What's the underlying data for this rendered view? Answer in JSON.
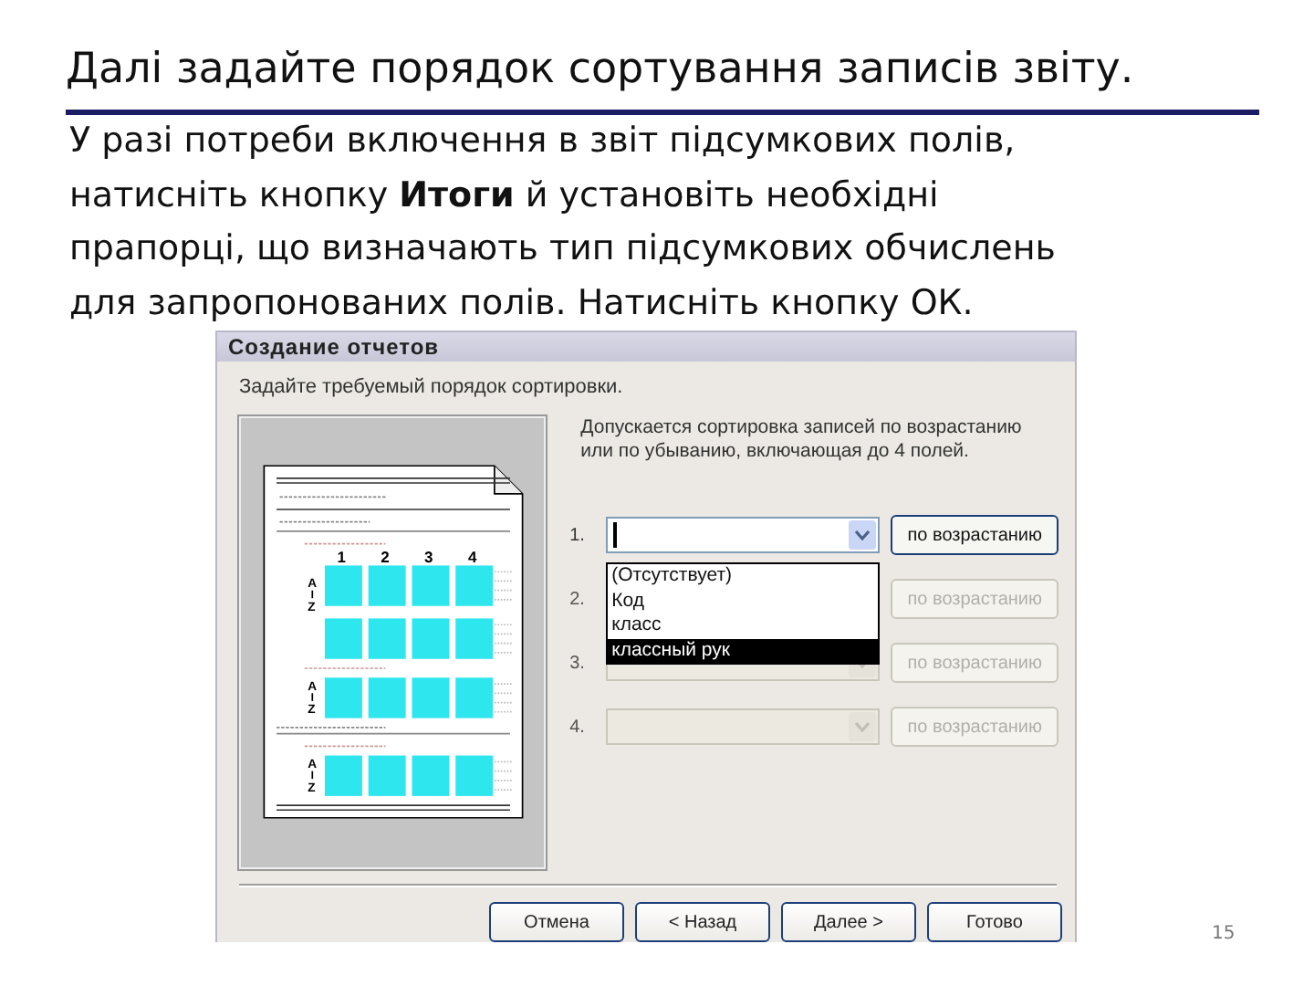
{
  "slide": {
    "title": "Далі задайте порядок сортування записів звіту.",
    "body": "У разі потреби включення в звіт підсумкових полів,\nнатисніть кнопку **Итоги** й установіть необхідні\nпрапорці, що визначають тип підсумкових обчислень\nдля запропонованих полів. Натисніть кнопку ОК.",
    "page_number": "15"
  },
  "dialog": {
    "title": "Создание отчетов",
    "instruction": "Задайте требуемый порядок сортировки.",
    "preview": {
      "column_numbers": [
        "1",
        "2",
        "3",
        "4"
      ],
      "sort_marks": [
        {
          "top": "A",
          "bottom": "Z"
        },
        {
          "top": "A",
          "bottom": "Z"
        },
        {
          "top": "A",
          "bottom": "Z"
        }
      ]
    },
    "description": "Допускается сортировка записей по возрастанию или по убыванию, включающая до 4 полей.",
    "sort_rows": [
      {
        "number": "1.",
        "enabled": true,
        "order": "по возрастанию"
      },
      {
        "number": "2.",
        "enabled": false,
        "order": "по возрастанию"
      },
      {
        "number": "3.",
        "enabled": false,
        "order": "по возрастанию"
      },
      {
        "number": "4.",
        "enabled": false,
        "order": "по возрастанию"
      }
    ],
    "dropdown": [
      {
        "label": "(Отсутствует)",
        "selected": false
      },
      {
        "label": "Код",
        "selected": false
      },
      {
        "label": "класс",
        "selected": false
      },
      {
        "label": "классный рук",
        "selected": true
      }
    ],
    "buttons": [
      "Отмена",
      "< Назад",
      "Далее >",
      "Готово"
    ]
  }
}
